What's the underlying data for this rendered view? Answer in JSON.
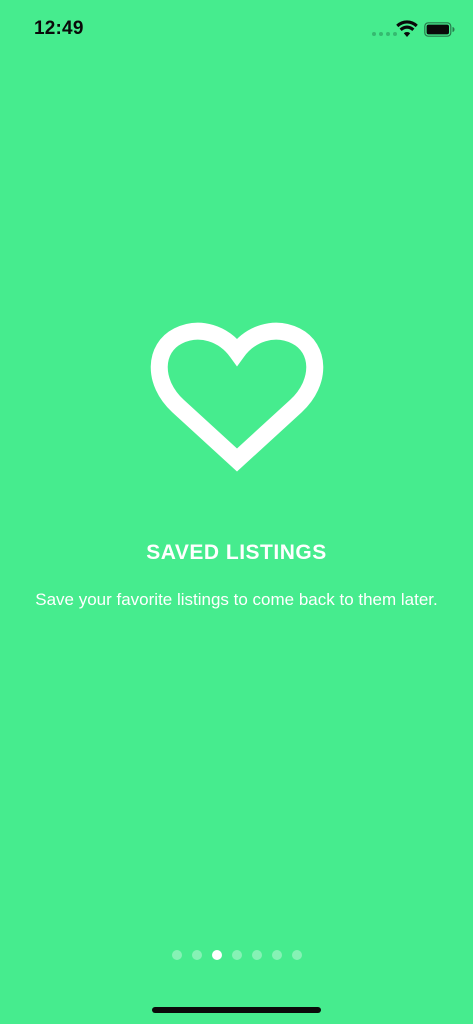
{
  "status_bar": {
    "time": "12:49",
    "icons": [
      "signal-dots-icon",
      "wifi-icon",
      "battery-icon"
    ]
  },
  "onboarding": {
    "icon": "heart-icon",
    "title": "SAVED LISTINGS",
    "subtitle": "Save your favorite listings to come back to them later."
  },
  "pagination": {
    "total_pages": 7,
    "current_page": 3
  },
  "colors": {
    "background": "#46EC8E",
    "foreground": "#FFFFFF",
    "status_text": "#0A0A0A"
  }
}
